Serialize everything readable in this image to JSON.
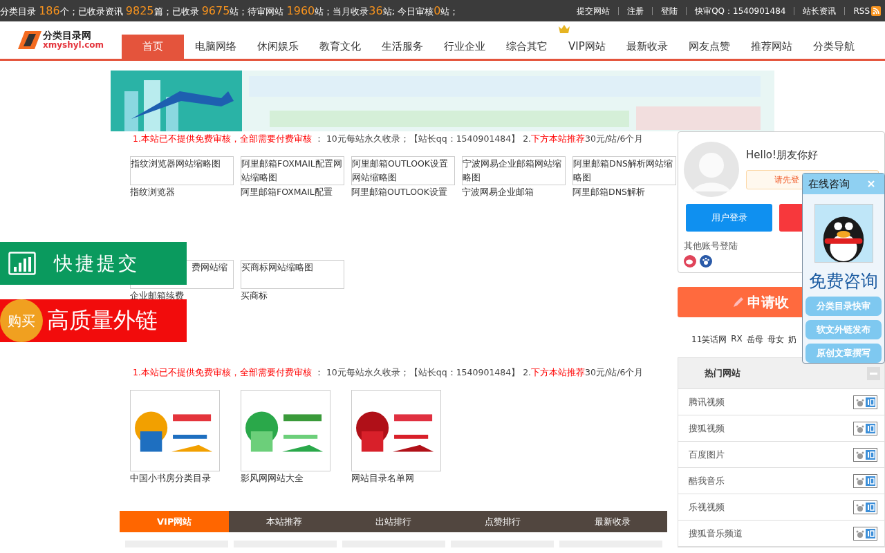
{
  "top_bar": {
    "stats": [
      {
        "label": "分类目录 ",
        "value": "186",
        "unit": "个；"
      },
      {
        "label": "已收录资讯 ",
        "value": "9825",
        "unit": "篇；"
      },
      {
        "label": "已收录 ",
        "value": "9675",
        "unit": "站；"
      },
      {
        "label": "待审网站 ",
        "value": "1960",
        "unit": "站；"
      },
      {
        "label": "当月收录",
        "value": "36",
        "unit": "站; "
      },
      {
        "label": "今日审核",
        "value": "0",
        "unit": "站；"
      }
    ],
    "links": [
      "提交网站",
      "注册",
      "登陆",
      "快审QQ：1540901484",
      "站长资讯",
      "RSS"
    ]
  },
  "logo": {
    "title": "分类目录网",
    "domain": "xmyshyl.com"
  },
  "nav": [
    {
      "label": "首页",
      "selected": true
    },
    {
      "label": "电脑网络",
      "selected": false
    },
    {
      "label": "休闲娱乐",
      "selected": false
    },
    {
      "label": "教育文化",
      "selected": false
    },
    {
      "label": "生活服务",
      "selected": false
    },
    {
      "label": "行业企业",
      "selected": false
    },
    {
      "label": "综合其它",
      "selected": false
    },
    {
      "label": "VIP网站",
      "selected": false,
      "badge": true
    },
    {
      "label": "最新收录",
      "selected": false
    },
    {
      "label": "网友点赞",
      "selected": false
    },
    {
      "label": "推荐网站",
      "selected": false
    },
    {
      "label": "分类导航",
      "selected": false
    }
  ],
  "banner": {
    "kind": "picture"
  },
  "notices": [
    [
      {
        "text": "1.本站已不提供免费审核，全部需要付费审核",
        "kind": "red"
      },
      {
        "text": " ： 10元每站永久收录；【站长qq：1540901484】 2.",
        "kind": "plain"
      },
      {
        "text": "下方本站推荐",
        "kind": "red"
      },
      {
        "text": "30元/站/6个月",
        "kind": "plain"
      }
    ],
    [
      {
        "text": "1.本站已不提供免费审核，全部需要付费审核",
        "kind": "red"
      },
      {
        "text": " ： 10元每站永久收录；【站长qq：1540901484】 2.",
        "kind": "plain"
      },
      {
        "text": "下方本站推荐",
        "kind": "red"
      },
      {
        "text": "30元/站/6个月",
        "kind": "plain"
      }
    ]
  ],
  "thumbs": [
    {
      "alt": "指纹浏览器网站缩略图",
      "caption": "指纹浏览器"
    },
    {
      "alt": "阿里邮箱FOXMAIL配置网站缩略图",
      "caption": "阿里邮箱FOXMAIL配置"
    },
    {
      "alt": "阿里邮箱OUTLOOK设置网站缩略图",
      "caption": "阿里邮箱OUTLOOK设置"
    },
    {
      "alt": "宁波网易企业邮箱网站缩略图",
      "caption": "宁波网易企业邮箱"
    },
    {
      "alt": "阿里邮箱DNS解析网站缩略图",
      "caption": "阿里邮箱DNS解析"
    },
    {
      "alt": "费网站缩",
      "caption": "企业邮箱续费",
      "covered": true
    },
    {
      "alt": "买商标网站缩略图",
      "caption": "买商标"
    }
  ],
  "logos": [
    {
      "caption": "中国小书房分类目录"
    },
    {
      "caption": "影风网网站大全"
    },
    {
      "caption": "网站目录名单网"
    }
  ],
  "tabs": [
    {
      "label": "VIP网站",
      "selected": true
    },
    {
      "label": "本站推荐",
      "selected": false
    },
    {
      "label": "出站排行",
      "selected": false
    },
    {
      "label": "点赞排行",
      "selected": false
    },
    {
      "label": "最新收录",
      "selected": false
    }
  ],
  "user_card": {
    "greeting": "Hello!朋友你好",
    "login_hint": "请先登",
    "buttons": [
      {
        "label": "用户登录",
        "kind": "login"
      },
      {
        "kind": "register"
      }
    ],
    "other_login": "其他账号登陆"
  },
  "apply_button": "申请收",
  "tags": [
    "11笑话网",
    "RX",
    "岳母",
    "母女",
    "奶"
  ],
  "hot_sites": {
    "title": "热门网站",
    "items": [
      "腾讯视频",
      "搜狐视频",
      "百度图片",
      "酷我音乐",
      "乐视视频",
      "搜狐音乐频道"
    ]
  },
  "float_ads": [
    {
      "kind": "submit",
      "text": "快捷提交"
    },
    {
      "kind": "buy",
      "badge": "购买",
      "text": "高质量外链"
    }
  ],
  "chat": {
    "title": "在线咨询",
    "headline": "免费咨询",
    "buttons": [
      "分类目录快审",
      "软文外链发布",
      "原创文章撰写"
    ]
  }
}
